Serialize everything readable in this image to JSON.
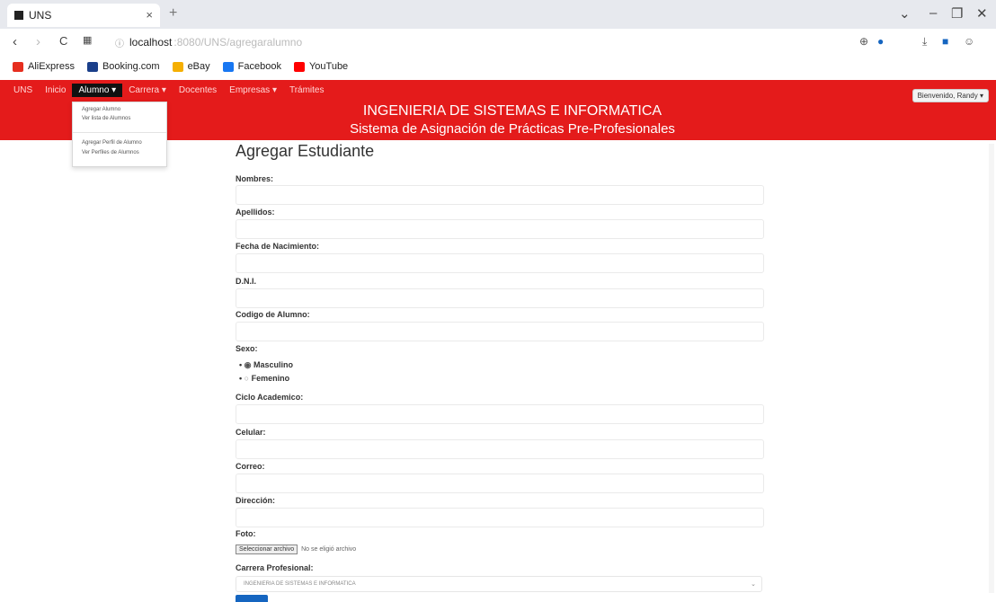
{
  "browser": {
    "tab_title": "UNS",
    "tab_close": "×",
    "new_tab": "+",
    "url_host": "localhost",
    "url_rest": ":8080/UNS/agregaralumno",
    "back": "‹",
    "forward": "›",
    "reload": "C"
  },
  "bookmarks": [
    {
      "label": "AliExpress",
      "color": "#e62e1f"
    },
    {
      "label": "Booking.com",
      "color": "#1a3f8a"
    },
    {
      "label": "eBay",
      "color": "#f5af02"
    },
    {
      "label": "Facebook",
      "color": "#1877f2"
    },
    {
      "label": "YouTube",
      "color": "#ff0000"
    }
  ],
  "site": {
    "nav": [
      "UNS",
      "Inicio",
      "Alumno ▾",
      "Carrera ▾",
      "Docentes",
      "Empresas ▾",
      "Trámites"
    ],
    "title": "INGENIERIA DE SISTEMAS E INFORMATICA",
    "subtitle": "Sistema de Asignación de Prácticas Pre-Profesionales",
    "welcome": "Bienvenido, Randy ▾",
    "dropdown": [
      "Agregar Alumno",
      "Ver lista de Alumnos",
      "Agregar Perfil de Alumno",
      "Ver Perfiles de Alumnos"
    ]
  },
  "form": {
    "heading": "Agregar Estudiante",
    "labels": {
      "nombres": "Nombres:",
      "apellidos": "Apellidos:",
      "fecha": "Fecha de Nacimiento:",
      "dni": "D.N.I.",
      "codigo": "Codigo de Alumno:",
      "sexo": "Sexo:",
      "ciclo": "Ciclo Academico:",
      "celular": "Celular:",
      "correo": "Correo:",
      "direccion": "Dirección:",
      "foto": "Foto:",
      "carrera": "Carrera Profesional:"
    },
    "sexo_options": [
      "Masculino",
      "Femenino"
    ],
    "sexo_selected": "Masculino",
    "file_button": "Seleccionar archivo",
    "file_status": "No se eligió archivo",
    "carrera_value": "INGENIERIA DE SISTEMAS E INFORMATICA"
  },
  "colors": {
    "brand_red": "#e41b1b",
    "nav_active": "#111111",
    "submit_blue": "#1565c0"
  }
}
